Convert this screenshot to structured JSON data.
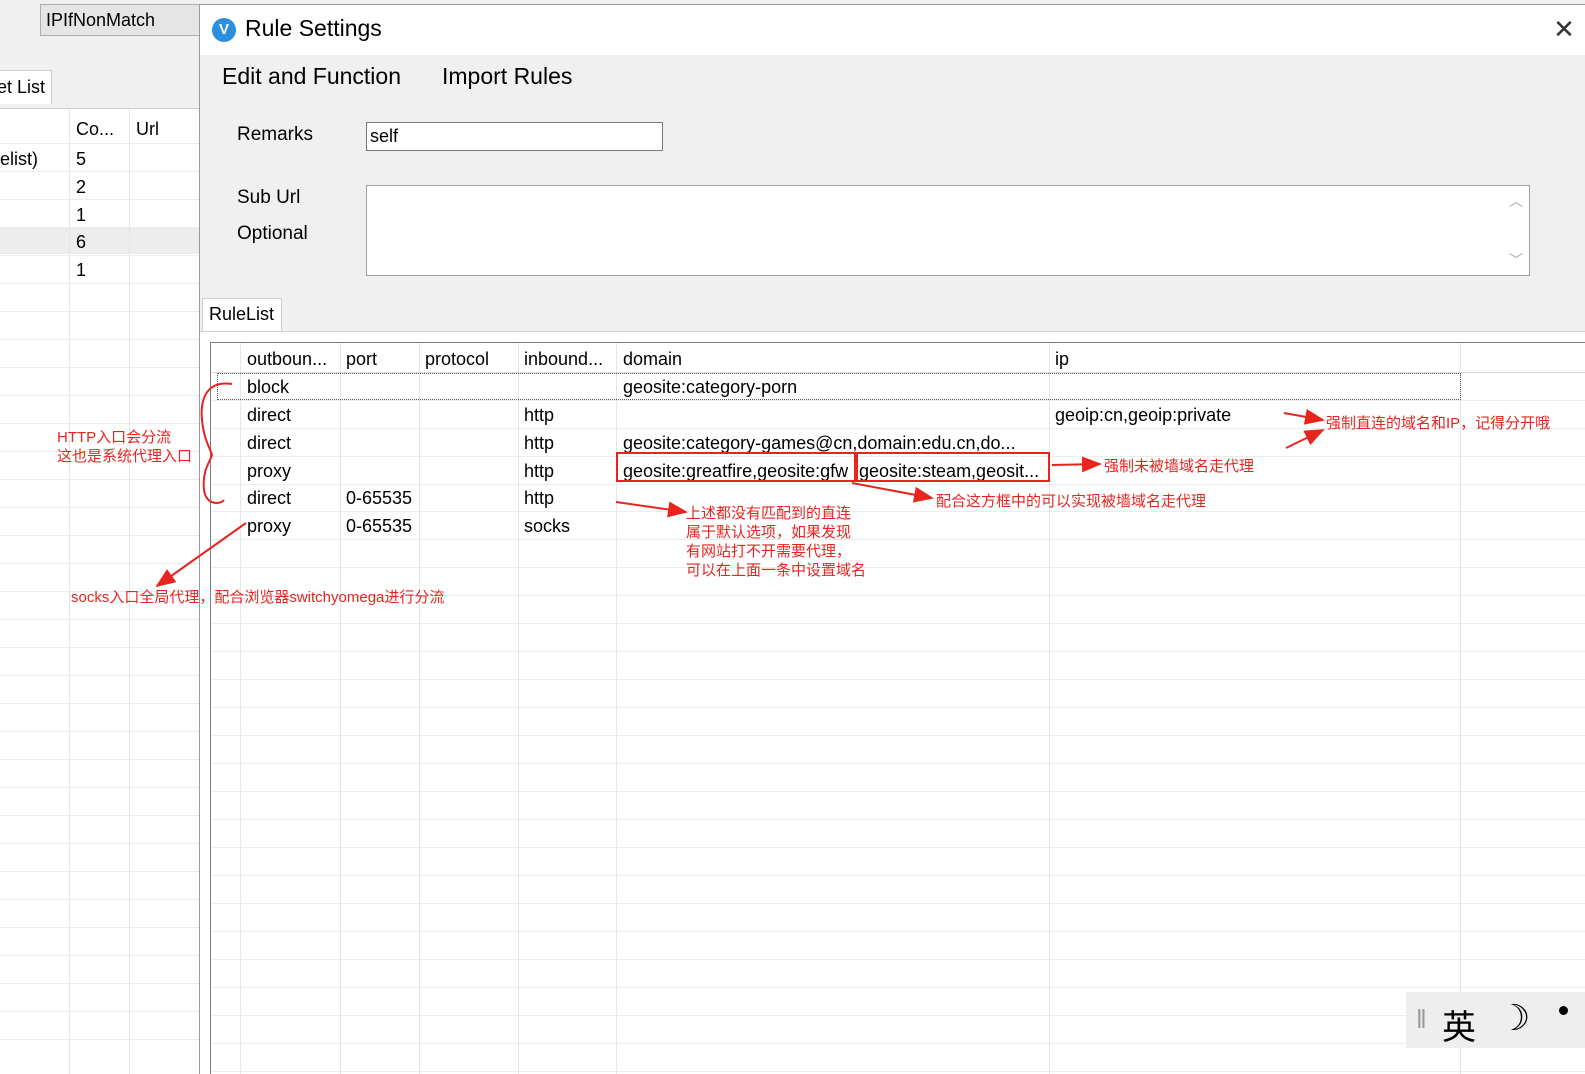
{
  "background_window": {
    "combo_value": "IPIfNonMatch",
    "tab_label": "et List",
    "columns": [
      "Co...",
      "Url"
    ],
    "rows": [
      {
        "name": "elist)",
        "count": "5"
      },
      {
        "name": "",
        "count": "2"
      },
      {
        "name": "",
        "count": "1"
      },
      {
        "name": "",
        "count": "6"
      },
      {
        "name": "",
        "count": "1"
      }
    ]
  },
  "dialog": {
    "title": "Rule Settings",
    "app_icon_glyph": "V",
    "close_glyph": "✕",
    "menu": {
      "edit": "Edit and Function",
      "import": "Import Rules"
    },
    "remarks_label": "Remarks",
    "remarks_value": "self",
    "suburl_label": "Sub Url",
    "optional_label": "Optional",
    "suburl_value": "",
    "scroll_up": "︿",
    "scroll_down": "﹀",
    "tab_label": "RuleList"
  },
  "rules_table": {
    "columns": [
      "outboun...",
      "port",
      "protocol",
      "inbound...",
      "domain",
      "ip"
    ],
    "rows": [
      {
        "outbound": "block",
        "port": "",
        "protocol": "",
        "inbound": "",
        "domain": "geosite:category-porn",
        "ip": ""
      },
      {
        "outbound": "direct",
        "port": "",
        "protocol": "",
        "inbound": "http",
        "domain": "",
        "ip": "geoip:cn,geoip:private"
      },
      {
        "outbound": "direct",
        "port": "",
        "protocol": "",
        "inbound": "http",
        "domain": "geosite:category-games@cn,domain:edu.cn,do...",
        "ip": ""
      },
      {
        "outbound": "proxy",
        "port": "",
        "protocol": "",
        "inbound": "http",
        "domain": "geosite:greatfire,geosite:gfw",
        "ip": "geosite:steam,geosit..."
      },
      {
        "outbound": "direct",
        "port": "0-65535",
        "protocol": "",
        "inbound": "http",
        "domain": "",
        "ip": ""
      },
      {
        "outbound": "proxy",
        "port": "0-65535",
        "protocol": "",
        "inbound": "socks",
        "domain": "",
        "ip": ""
      }
    ]
  },
  "annotations": {
    "http_note_line1": "HTTP入口会分流",
    "http_note_line2": "这也是系统代理入口",
    "direct_note": "强制直连的域名和IP，记得分开哦",
    "blocked_note": "强制未被墙域名走代理",
    "combo_note": "配合这方框中的可以实现被墙域名走代理",
    "default_note_line1": "上述都没有匹配到的直连",
    "default_note_line2": "属于默认选项，如果发现",
    "default_note_line3": "有网站打不开需要代理，",
    "default_note_line4": "可以在上面一条中设置域名",
    "socks_note": "socks入口全局代理，配合浏览器switchyomega进行分流",
    "color": "#e8241f"
  },
  "ime": {
    "grip": "‖",
    "language": "英",
    "mode": "☽"
  }
}
